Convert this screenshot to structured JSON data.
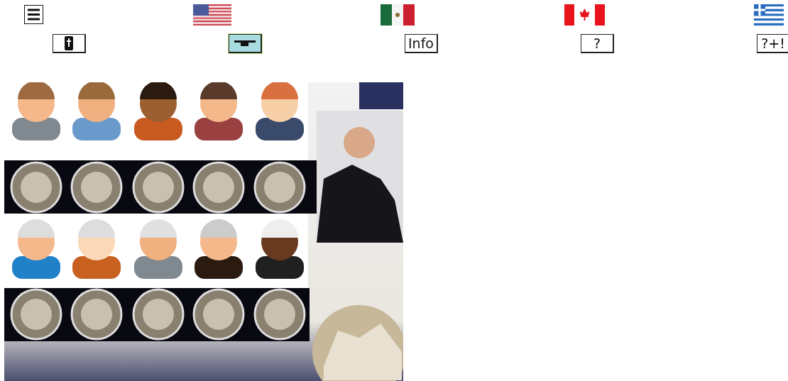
{
  "buttons": [
    {
      "kind": "book",
      "selected": false
    },
    {
      "kind": "cap",
      "selected": true
    },
    {
      "kind": "text",
      "label": "Info",
      "selected": false
    },
    {
      "kind": "text",
      "label": "?",
      "selected": false
    },
    {
      "kind": "text",
      "label": "?+!",
      "selected": false
    }
  ]
}
